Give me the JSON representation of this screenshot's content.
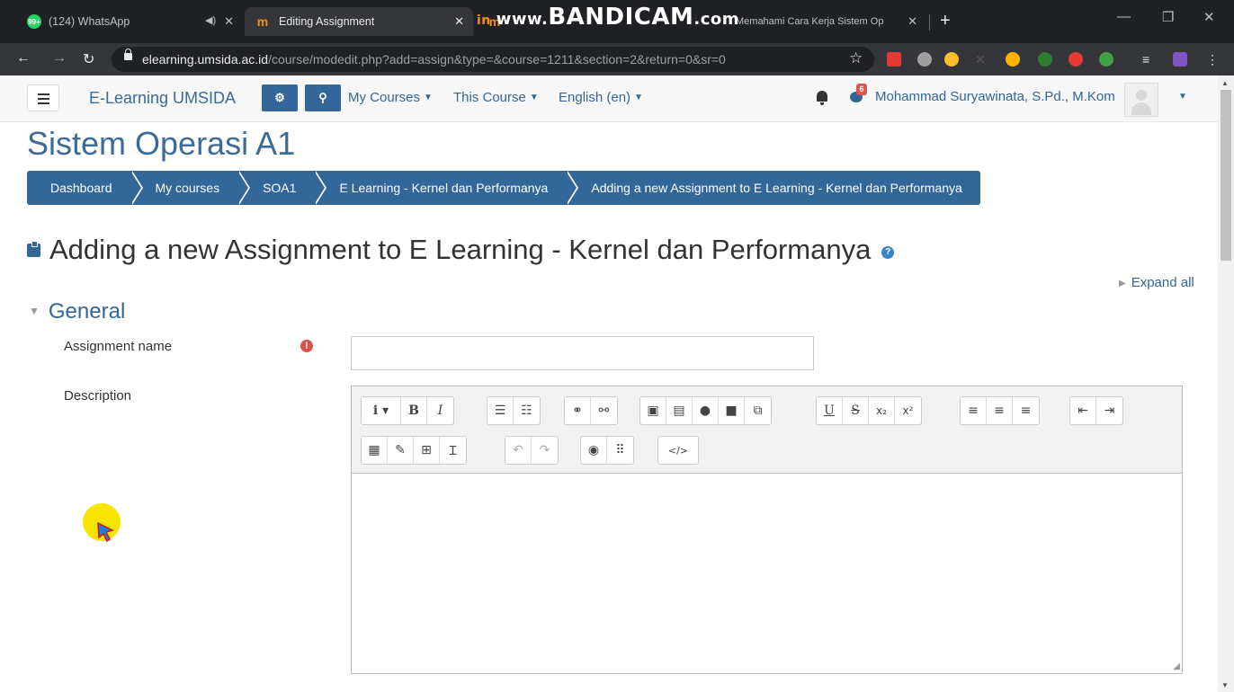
{
  "browser": {
    "tabs": [
      {
        "title": "(124) WhatsApp",
        "favicon": "whatsapp-icon",
        "badge": "99+"
      },
      {
        "title": "Editing Assignment",
        "favicon": "moodle-icon",
        "active": true
      },
      {
        "title": "Memahami Cara Kerja Sistem Op",
        "favicon": "moodle-icon"
      }
    ],
    "watermark": {
      "prefix": "in",
      "www": "www.",
      "brand": "BANDICAM",
      "tld": ".com"
    },
    "url": {
      "host": "elearning.umsida.ac.id",
      "path": "/course/modedit.php?add=assign&type=&course=1211&section=2&return=0&sr=0"
    }
  },
  "navbar": {
    "brand": "E-Learning UMSIDA",
    "menus": [
      "My Courses",
      "This Course",
      "English (en)"
    ],
    "message_count": "6",
    "user_name": "Mohammad Suryawinata, S.Pd., M.Kom"
  },
  "course_title": "Sistem Operasi A1",
  "breadcrumbs": [
    "Dashboard",
    "My courses",
    "SOA1",
    "E Learning - Kernel dan Performanya",
    "Adding a new Assignment to E Learning - Kernel dan Performanya"
  ],
  "page_heading": "Adding a new Assignment to E Learning - Kernel dan Performanya",
  "expand_all": "Expand all",
  "section": {
    "title": "General"
  },
  "form": {
    "assignment_name_label": "Assignment name",
    "assignment_name_value": "",
    "description_label": "Description",
    "description_value": ""
  },
  "editor_toolbar": {
    "row1": [
      [
        "i ▾",
        "B",
        "I"
      ],
      [
        "list-bullet-icon",
        "list-numbered-icon"
      ],
      [
        "link-icon",
        "unlink-icon"
      ],
      [
        "image-icon",
        "media-icon",
        "record-audio-icon",
        "record-video-icon",
        "manage-files-icon"
      ],
      [
        "U",
        "S",
        "x₂",
        "x²"
      ],
      [
        "align-left-icon",
        "align-center-icon",
        "align-right-icon"
      ],
      [
        "outdent-icon",
        "indent-icon"
      ]
    ],
    "row2": [
      [
        "equation-icon",
        "edit-icon",
        "table-icon",
        "clear-format-icon"
      ],
      [
        "undo-icon",
        "redo-icon"
      ],
      [
        "accessibility-icon",
        "screenreader-icon"
      ],
      [
        "html-icon"
      ]
    ]
  },
  "colors": {
    "brand_blue": "#336699",
    "required_red": "#d9534f",
    "cursor_highlight": "#f7e500"
  }
}
